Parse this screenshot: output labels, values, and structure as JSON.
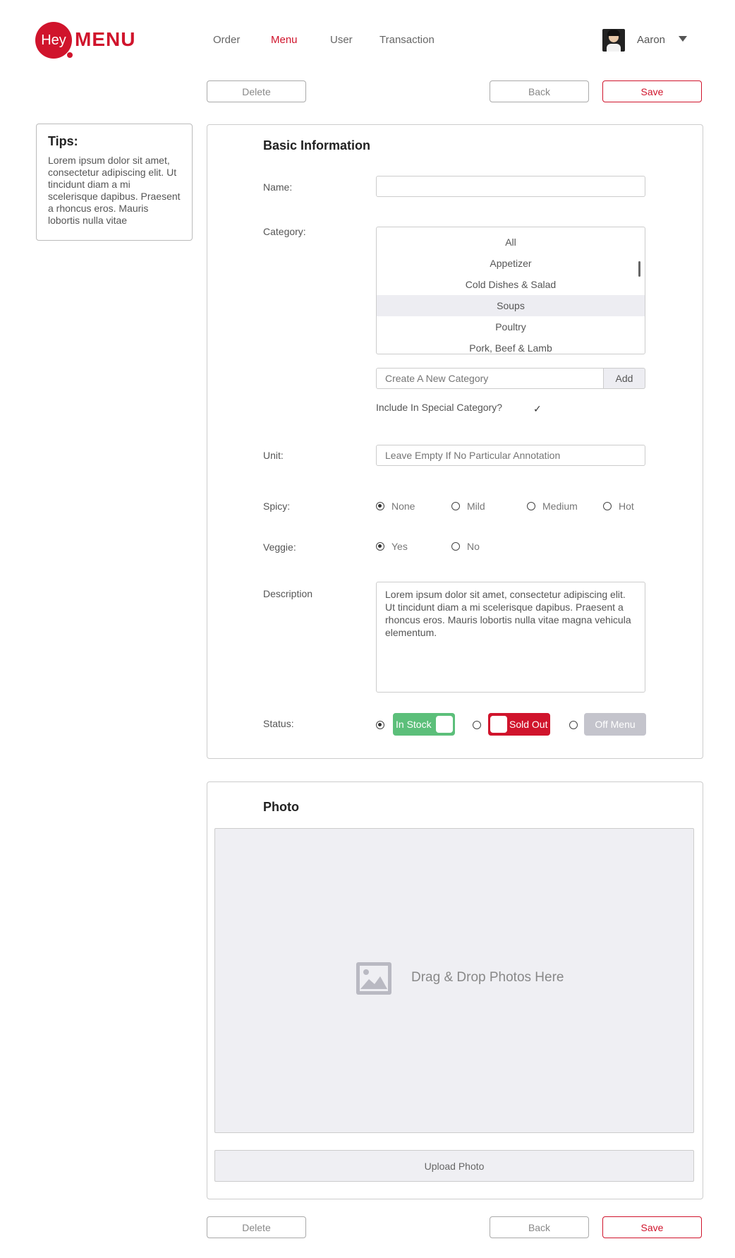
{
  "brand": {
    "logo_hey": "Hey",
    "logo_menu": "MENU",
    "accent_color": "#d0142c"
  },
  "nav": {
    "items": [
      "Order",
      "Menu",
      "User",
      "Transaction"
    ],
    "active": "Menu"
  },
  "user": {
    "name": "Aaron",
    "avatar_icon": "user-avatar",
    "menu_icon": "caret-down-icon"
  },
  "toolbar": {
    "delete_label": "Delete",
    "back_label": "Back",
    "save_label": "Save"
  },
  "tips": {
    "title": "Tips:",
    "body": "Lorem ipsum dolor sit amet, consectetur adipiscing elit. Ut tincidunt diam a mi scelerisque dapibus. Praesent a rhoncus eros. Mauris lobortis nulla vitae"
  },
  "basic_info": {
    "title": "Basic Information",
    "name_label": "Name:",
    "name_value": "",
    "category_label": "Category:",
    "categories": [
      "All",
      "Appetizer",
      "Cold Dishes & Salad",
      "Soups",
      "Poultry",
      "Pork, Beef & Lamb"
    ],
    "selected_category": "Soups",
    "new_category_placeholder": "Create A New Category",
    "add_label": "Add",
    "special_label": "Include In Special Category?",
    "special_checked": true,
    "unit_label": "Unit:",
    "unit_placeholder": "Leave Empty If No Particular Annotation",
    "spicy_label": "Spicy:",
    "spicy_options": [
      "None",
      "Mild",
      "Medium",
      "Hot"
    ],
    "spicy_selected": "None",
    "veggie_label": "Veggie:",
    "veggie_options": [
      "Yes",
      "No"
    ],
    "veggie_selected": "Yes",
    "description_label": "Description",
    "description_value": "Lorem ipsum dolor sit amet, consectetur adipiscing elit. Ut tincidunt diam a mi scelerisque dapibus. Praesent a rhoncus eros. Mauris lobortis nulla vitae magna vehicula elementum.",
    "status_label": "Status:",
    "status_options": [
      "In Stock",
      "Sold Out",
      "Off Menu"
    ],
    "status_selected": "In Stock",
    "status_colors": {
      "in_stock": "#5cbf7a",
      "sold_out": "#d0142c",
      "off_menu": "#c4c4cc"
    }
  },
  "photo": {
    "title": "Photo",
    "drop_text": "Drag & Drop Photos Here",
    "image_icon": "image-placeholder-icon",
    "upload_label": "Upload Photo"
  }
}
